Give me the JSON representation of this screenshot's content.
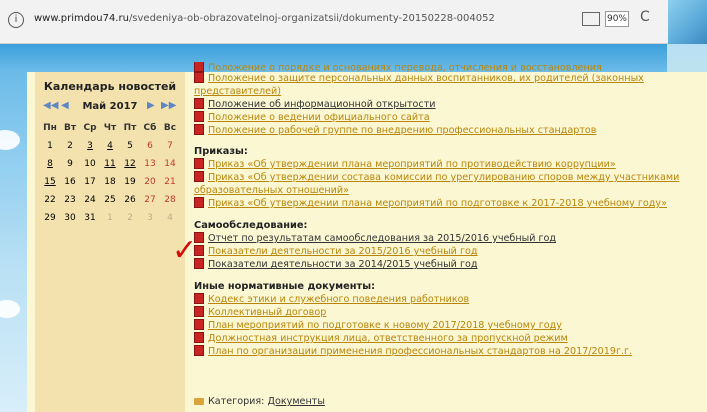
{
  "browser": {
    "url_host": "www.primdou74.ru",
    "url_path": "/svedeniya-ob-obrazovatelnoj-organizatsii/dokumenty-20150228-004052",
    "zoom": "90%",
    "info_glyph": "i",
    "reload_glyph": "C"
  },
  "calendar": {
    "title": "Календарь новостей",
    "month": "Май 2017",
    "weekdays": [
      "Пн",
      "Вт",
      "Ср",
      "Чт",
      "Пт",
      "Сб",
      "Вс"
    ],
    "weeks": [
      [
        "1",
        "2",
        "3",
        "4",
        "5",
        "6",
        "7"
      ],
      [
        "8",
        "9",
        "10",
        "11",
        "12",
        "13",
        "14"
      ],
      [
        "15",
        "16",
        "17",
        "18",
        "19",
        "20",
        "21"
      ],
      [
        "22",
        "23",
        "24",
        "25",
        "26",
        "27",
        "28"
      ],
      [
        "29",
        "30",
        "31",
        "1",
        "2",
        "3",
        "4"
      ]
    ]
  },
  "documents": {
    "partial_top": "Положение о порядке и основаниях перевода, отчисления и восстановления",
    "group1": [
      "Положение о защите персональных данных воспитанников, их родителей (законных представителей)",
      "Положение об информационной открытости",
      "Положение о ведении официального сайта",
      "Положение о рабочей группе по внедрению профессиональных стандартов"
    ],
    "orders_header": "Приказы:",
    "orders": [
      "Приказ «Об утверждении плана мероприятий по противодействию коррупции»",
      "Приказ «Об утверждении состава комиссии по урегулированию споров между участниками образовательных отношений»",
      "Приказ «Об утверждении плана мероприятий по подготовке к 2017-2018 учебному году»"
    ],
    "self_header": "Самообследование:",
    "self": [
      "Отчет по результатам самообследования за 2015/2016 учебный год",
      "Показатели деятельности за 2015/2016 учебный год",
      "Показатели деятельности за 2014/2015 учебный год"
    ],
    "other_header": "Иные нормативные документы:",
    "other": [
      "Кодекс этики и служебного поведения работников",
      "Коллективный договор",
      "План мероприятий по подготовке к новому 2017/2018 учебному году",
      "Должностная инструкция лица, ответственного за пропускной режим",
      "План по организации применения профессиональных стандартов на 2017/2019г.г."
    ],
    "category_label": "Категория:",
    "category_link": "Документы"
  },
  "colors": {
    "link_gold": "#b8860b",
    "link_dark": "#333333",
    "pdf_red": "#c82424",
    "check_red": "#d60a0a"
  }
}
